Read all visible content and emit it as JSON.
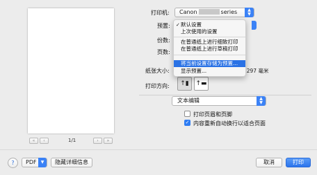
{
  "preview": {
    "page_indicator": "1/1",
    "nav": [
      "«",
      "‹",
      "›",
      "»"
    ]
  },
  "printer": {
    "label": "打印机:",
    "value_prefix": "Canon",
    "value_suffix": "series"
  },
  "presets": {
    "label": "预置:",
    "menu": {
      "checked_item": "默认设置",
      "items": [
        "上次使用的设置",
        "在普通纸上进行细致打印",
        "在普通纸上进行草稿打印",
        "将当前设置存储为预置...",
        "显示预置..."
      ],
      "selected": "将当前设置存储为预置..."
    }
  },
  "copies": {
    "label": "份数:"
  },
  "pages": {
    "label": "页数:"
  },
  "paper_size": {
    "label": "纸张大小:",
    "value": "10 x 297 毫米"
  },
  "orientation": {
    "label": "打印方向:"
  },
  "section": {
    "value": "文本编辑"
  },
  "options": [
    {
      "label": "打印页眉和页脚",
      "checked": false
    },
    {
      "label": "内容重新自动换行以适合页面",
      "checked": true
    }
  ],
  "bottom": {
    "help": "?",
    "pdf": "PDF",
    "hide_details": "隐藏详细信息",
    "cancel": "取消",
    "print": "打印"
  },
  "colors": {
    "accent": "#2a72e5",
    "background": "#ececec"
  }
}
